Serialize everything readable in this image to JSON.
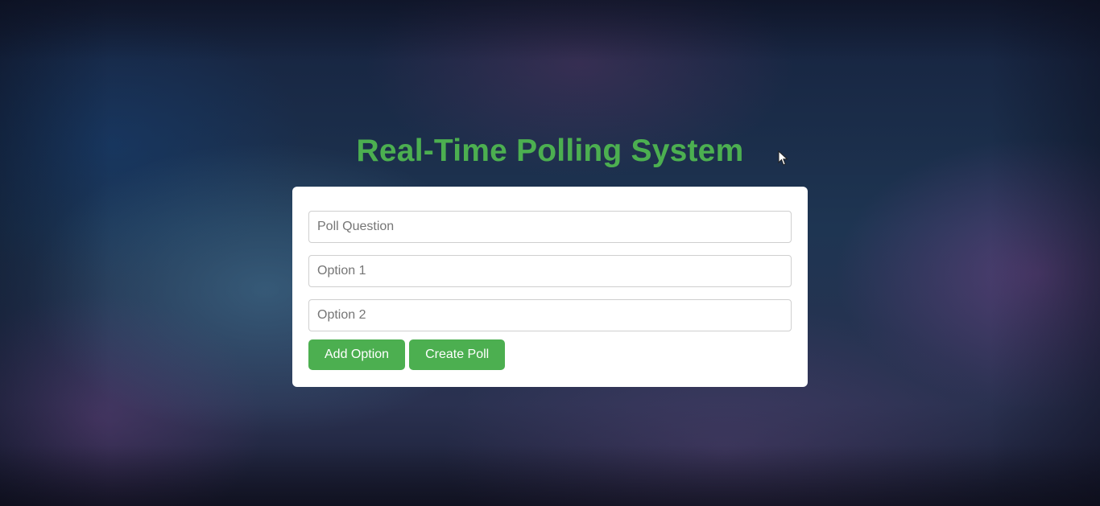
{
  "page": {
    "title": "Real-Time Polling System"
  },
  "form": {
    "question_placeholder": "Poll Question",
    "question_value": "",
    "option1_placeholder": "Option 1",
    "option1_value": "",
    "option2_placeholder": "Option 2",
    "option2_value": ""
  },
  "buttons": {
    "add_option_label": "Add Option",
    "create_poll_label": "Create Poll"
  },
  "theme": {
    "accent": "#4caf50",
    "card_background": "#ffffff"
  },
  "icons": {
    "cursor": "mouse-pointer-icon"
  }
}
